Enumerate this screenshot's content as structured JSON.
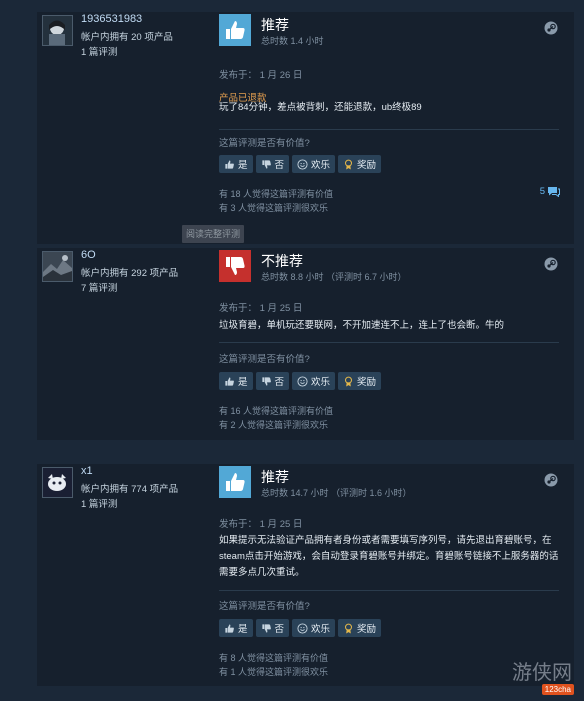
{
  "reviews": [
    {
      "username": "1936531983",
      "products": "帐户内拥有 20 项产品",
      "review_count": "1 篇评测",
      "verdict": "推荐",
      "hours": "总时数 1.4 小时",
      "date": "发布于：  1 月 26 日",
      "refunded": "产品已退款",
      "body": "玩了84分钟，差点被背刺，还能退款，ub终极89",
      "helpful_question": "这篇评测是否有价值?",
      "votes": {
        "yes": "是",
        "no": "否",
        "funny": "欢乐",
        "award": "奖励"
      },
      "helpful_count": "有 18 人觉得这篇评测有价值",
      "funny_count": "有 3 人觉得这篇评测很欢乐",
      "comments": "5",
      "read_more": "阅读完整评测"
    },
    {
      "username": "6O",
      "products": "帐户内拥有 292 项产品",
      "review_count": "7 篇评测",
      "verdict": "不推荐",
      "hours": "总时数 8.8 小时  （评测时 6.7 小时）",
      "date": "发布于：  1 月 25 日",
      "body": "垃圾育碧，单机玩还要联网，不开加速连不上，连上了也会断。牛的",
      "helpful_question": "这篇评测是否有价值?",
      "votes": {
        "yes": "是",
        "no": "否",
        "funny": "欢乐",
        "award": "奖励"
      },
      "helpful_count": "有 16 人觉得这篇评测有价值",
      "funny_count": "有 2 人觉得这篇评测很欢乐"
    },
    {
      "username": "x1",
      "products": "帐户内拥有 774 项产品",
      "review_count": "1 篇评测",
      "verdict": "推荐",
      "hours": "总时数 14.7 小时  （评测时 1.6 小时）",
      "date": "发布于：  1 月 25 日",
      "body": "如果提示无法验证产品拥有者身份或者需要填写序列号，请先退出育碧账号，在steam点击开始游戏，会自动登录育碧账号并绑定。育碧账号链接不上服务器的话需要多点几次重试。",
      "helpful_question": "这篇评测是否有价值?",
      "votes": {
        "yes": "是",
        "no": "否",
        "funny": "欢乐",
        "award": "奖励"
      },
      "helpful_count": "有 8 人觉得这篇评测有价值",
      "funny_count": "有 1 人觉得这篇评测很欢乐"
    }
  ],
  "watermark": {
    "text": "游侠网",
    "badge": "123cha"
  },
  "colors": {
    "recommend": "#52a8d6",
    "not_recommend": "#c5302d",
    "refunded": "#e59f4f",
    "link": "#67b7ef"
  }
}
